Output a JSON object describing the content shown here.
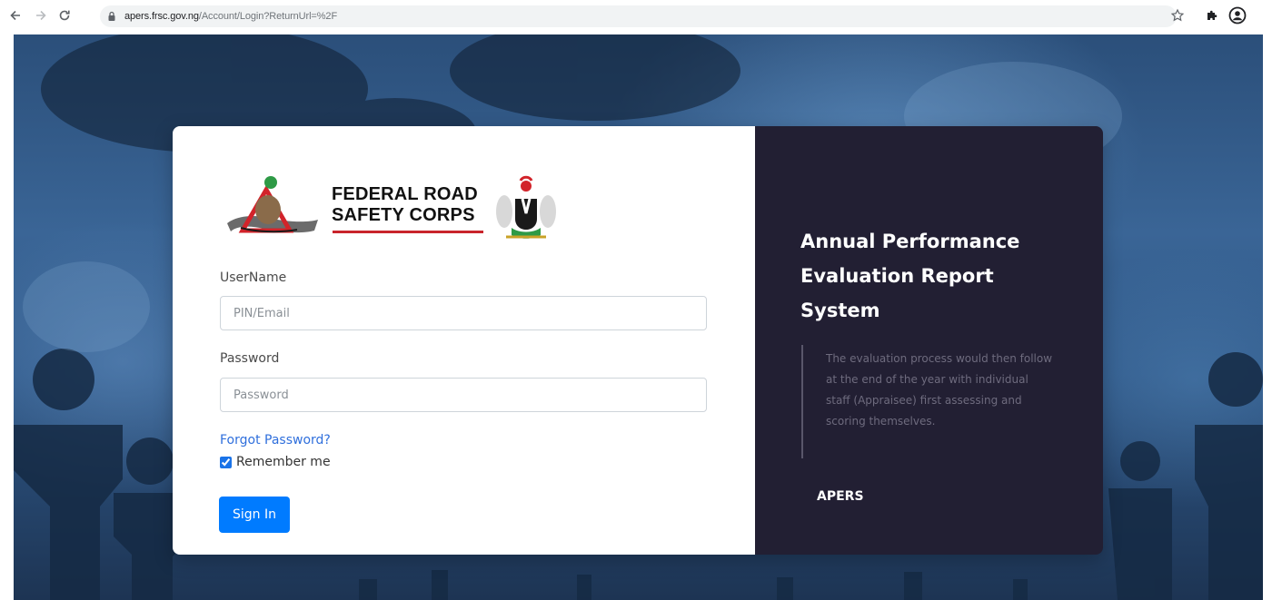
{
  "browser": {
    "url_host": "apers.frsc.gov.ng",
    "url_path": "/Account/Login?ReturnUrl=%2F"
  },
  "logo": {
    "line1": "FEDERAL ROAD",
    "line2": "SAFETY CORPS"
  },
  "form": {
    "username_label": "UserName",
    "username_placeholder": "PIN/Email",
    "password_label": "Password",
    "password_placeholder": "Password",
    "forgot_link": "Forgot Password?",
    "remember_label": "Remember me",
    "remember_checked": true,
    "signin_label": "Sign In"
  },
  "panel": {
    "title": "Annual Performance Evaluation Report System",
    "quote": "The evaluation process would then follow at the end of the year with individual staff (Appraisee) first assessing and scoring themselves.",
    "brand": "APERS"
  },
  "colors": {
    "primary_button": "#007bff",
    "panel_bg": "#221f33",
    "link": "#2f6fdc"
  }
}
